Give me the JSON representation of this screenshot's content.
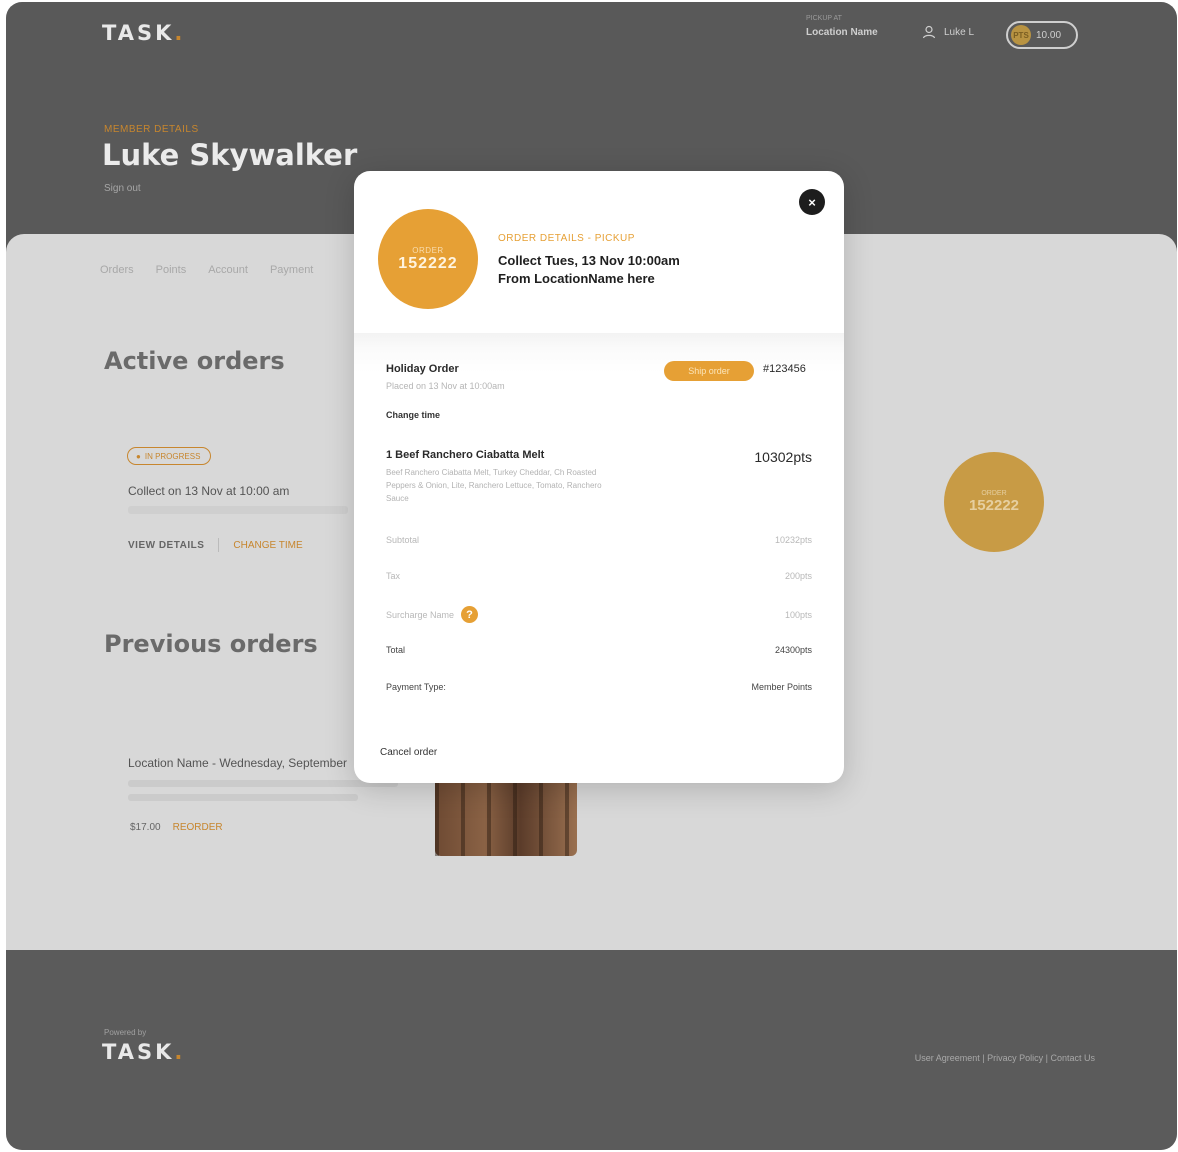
{
  "header": {
    "logo": "TASK",
    "logo_dot": ".",
    "location_small": "PICKUP AT",
    "location_name": "Location Name",
    "user_name": "Luke L",
    "points": "10.00",
    "coin_label": "PTS"
  },
  "member": {
    "kicker": "MEMBER DETAILS",
    "name": "Luke Skywalker",
    "sign_out": "Sign out"
  },
  "tabs": [
    "Orders",
    "Points",
    "Account",
    "Payment"
  ],
  "active_orders": {
    "title": "Active orders",
    "badge": "IN PROGRESS",
    "collect": "Collect on 13 Nov at 10:00 am",
    "view_details": "VIEW DETAILS",
    "change_time": "CHANGE TIME",
    "circle_label": "ORDER",
    "circle_number": "152222"
  },
  "previous_orders": {
    "title": "Previous orders",
    "location": "Location Name - Wednesday, September",
    "price": "$17.00",
    "reorder": "REORDER"
  },
  "footer": {
    "powered_by": "Powered by",
    "logo": "TASK",
    "logo_dot": ".",
    "links": "User Agreement | Privacy Policy | Contact Us"
  },
  "modal": {
    "close": "×",
    "circle_label": "ORDER",
    "circle_number": "152222",
    "kicker": "ORDER DETAILS - PICKUP",
    "line1": "Collect Tues, 13 Nov 10:00am",
    "line2": "From LocationName here",
    "order_title": "Holiday Order",
    "placed": "Placed on 13 Nov at 10:00am",
    "change_time": "Change time",
    "ship_label": "Ship order",
    "order_number": "#123456",
    "item_name": "1 Beef Ranchero Ciabatta Melt",
    "item_points": "10302pts",
    "item_desc": "Beef Ranchero Ciabatta Melt, Turkey Cheddar, Ch Roasted Peppers & Onion, Lite, Ranchero Lettuce, Tomato, Ranchero Sauce",
    "subtotal_label": "Subtotal",
    "subtotal_value": "10232pts",
    "tax_label": "Tax",
    "tax_value": "200pts",
    "surcharge_label": "Surcharge Name",
    "surcharge_icon": "?",
    "surcharge_value": "100pts",
    "total_label": "Total",
    "total_value": "24300pts",
    "payment_label": "Payment Type:",
    "payment_value": "Member Points",
    "cancel": "Cancel order"
  },
  "colors": {
    "accent": "#e6a035",
    "header_bg": "#595959",
    "content_bg": "#d8d8d8"
  }
}
